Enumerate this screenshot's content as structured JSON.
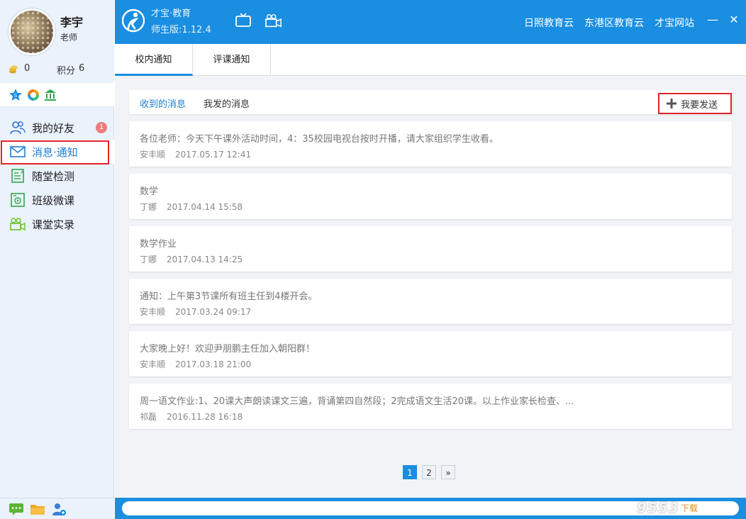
{
  "user": {
    "name": "李宇",
    "role": "老师",
    "coins": "0",
    "points_label": "积分",
    "points": "6"
  },
  "nav": {
    "friends": {
      "label": "我的好友",
      "badge": "1"
    },
    "messages": {
      "label": "消息·通知"
    },
    "quiz": {
      "label": "随堂检测"
    },
    "microlesson": {
      "label": "班级微课"
    },
    "record": {
      "label": "课堂实录"
    }
  },
  "header": {
    "brand": "才宝·教育",
    "version": "师生版:1.12.4",
    "links": [
      "日照教育云",
      "东港区教育云",
      "才宝网站"
    ],
    "minimize": "—",
    "close": "✕"
  },
  "tabs": [
    "校内通知",
    "评课通知"
  ],
  "filters": {
    "received": "收到的消息",
    "sent": "我发的消息",
    "send_button": "我要发送"
  },
  "messages": [
    {
      "title": "各位老师：今天下午课外活动时间，4：35校园电视台按时开播，请大家组织学生收看。",
      "author": "安丰顺",
      "date": "2017.05.17 12:41"
    },
    {
      "title": "数学",
      "author": "丁娜",
      "date": "2017.04.14 15:58"
    },
    {
      "title": "数学作业",
      "author": "丁娜",
      "date": "2017.04.13 14:25"
    },
    {
      "title": "通知：上午第3节课所有班主任到4楼开会。",
      "author": "安丰顺",
      "date": "2017.03.24 09:17"
    },
    {
      "title": "大家晚上好！欢迎尹朋鹏主任加入朝阳群！",
      "author": "安丰顺",
      "date": "2017.03.18 21:00"
    },
    {
      "title": "周一语文作业:1、20课大声朗读课文三遍，背诵第四自然段；2完成语文生活20课。以上作业家长检查、...",
      "author": "祁磊",
      "date": "2016.11.28 16:18"
    }
  ],
  "pager": {
    "page1": "1",
    "page2": "2",
    "next": "»"
  },
  "watermark": {
    "brand": "9553",
    "sub": "下载"
  },
  "colors": {
    "primary": "#1a8ee1",
    "highlight": "#e0252b"
  }
}
